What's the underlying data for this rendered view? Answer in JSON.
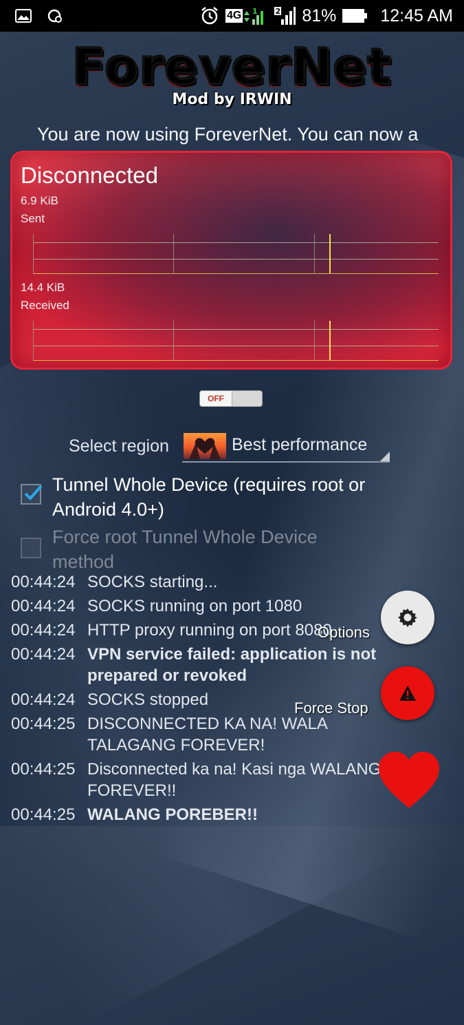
{
  "status_bar": {
    "left_icons": [
      "image-icon",
      "data-saver-icon"
    ],
    "right_icons": [
      "alarm-icon",
      "4g-signal-icon",
      "sim2-signal-icon",
      "battery-icon"
    ],
    "network": "4G",
    "sim1": "1",
    "sim2": "2",
    "battery": "81%",
    "time": "12:45 AM"
  },
  "app": {
    "logo_title": "ForeverNet",
    "logo_subtitle": "Mod by IRWIN",
    "marquee": "You are now using ForeverNet. You can now a"
  },
  "panel": {
    "status": "Disconnected",
    "sent_value": "6.9 KiB",
    "sent_label": "Sent",
    "received_value": "14.4 KiB",
    "received_label": "Received",
    "accent": "#e5243a"
  },
  "toggle": {
    "label": "OFF",
    "state": false
  },
  "region": {
    "label": "Select region",
    "value": "Best performance"
  },
  "options": {
    "tunnel_whole_device": {
      "label": "Tunnel Whole Device (requires root or Android 4.0+)",
      "checked": true
    },
    "force_root_tunnel": {
      "label": "Force root Tunnel Whole Device method",
      "checked": false,
      "enabled": false
    }
  },
  "log": [
    {
      "time": "00:44:24",
      "message": "SOCKS starting...",
      "bold": false
    },
    {
      "time": "00:44:24",
      "message": "SOCKS running on port 1080",
      "bold": false
    },
    {
      "time": "00:44:24",
      "message": "HTTP proxy running on port 8080",
      "bold": false
    },
    {
      "time": "00:44:24",
      "message": "VPN service failed: application is not prepared or revoked",
      "bold": true
    },
    {
      "time": "00:44:24",
      "message": "SOCKS stopped",
      "bold": false
    },
    {
      "time": "00:44:25",
      "message": "DISCONNECTED KA NA! WALA TALAGANG FOREVER!",
      "bold": false
    },
    {
      "time": "00:44:25",
      "message": "Disconnected ka na! Kasi nga WALANG FOREVER!!",
      "bold": false
    },
    {
      "time": "00:44:25",
      "message": "WALANG POREBER!!",
      "bold": true
    }
  ],
  "fabs": {
    "options_label": "Options",
    "force_stop_label": "Force Stop",
    "options_icon": "gear-icon",
    "force_stop_icon": "warning-icon",
    "favorite_icon": "heart-icon",
    "force_stop_color": "#e8110f",
    "heart_color": "#e8110f"
  }
}
